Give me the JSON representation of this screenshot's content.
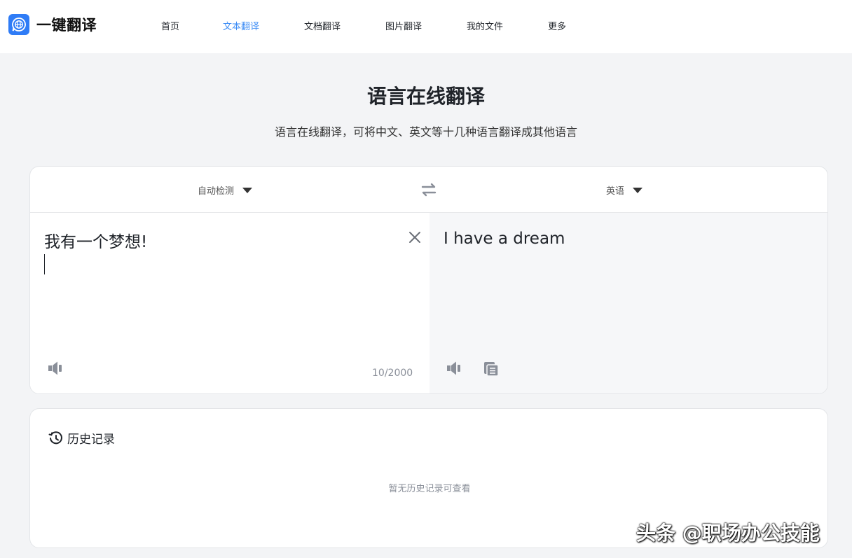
{
  "brand": {
    "name": "一键翻译"
  },
  "nav": {
    "items": [
      {
        "label": "首页"
      },
      {
        "label": "文本翻译"
      },
      {
        "label": "文档翻译"
      },
      {
        "label": "图片翻译"
      },
      {
        "label": "我的文件"
      },
      {
        "label": "更多"
      }
    ],
    "active_index": 1
  },
  "hero": {
    "title": "语言在线翻译",
    "subtitle": "语言在线翻译，可将中文、英文等十几种语言翻译成其他语言"
  },
  "translator": {
    "source_language": "自动检测",
    "target_language": "英语",
    "source_text": "我有一个梦想!",
    "char_count": "10/2000",
    "translated_text": "I have a dream"
  },
  "history": {
    "title": "历史记录",
    "empty_text": "暂无历史记录可查看"
  },
  "watermark": "头条 @职场办公技能",
  "colors": {
    "accent": "#3a8bf5",
    "brand_logo": "#2f7cf6",
    "page_bg": "#f3f4f6",
    "result_bg": "#f6f7f9",
    "icon_gray": "#8a8f99"
  },
  "icons": [
    "globe-chat-icon",
    "caret-down-icon",
    "swap-arrows-icon",
    "close-icon",
    "speaker-icon",
    "copy-icon",
    "history-clock-icon"
  ]
}
